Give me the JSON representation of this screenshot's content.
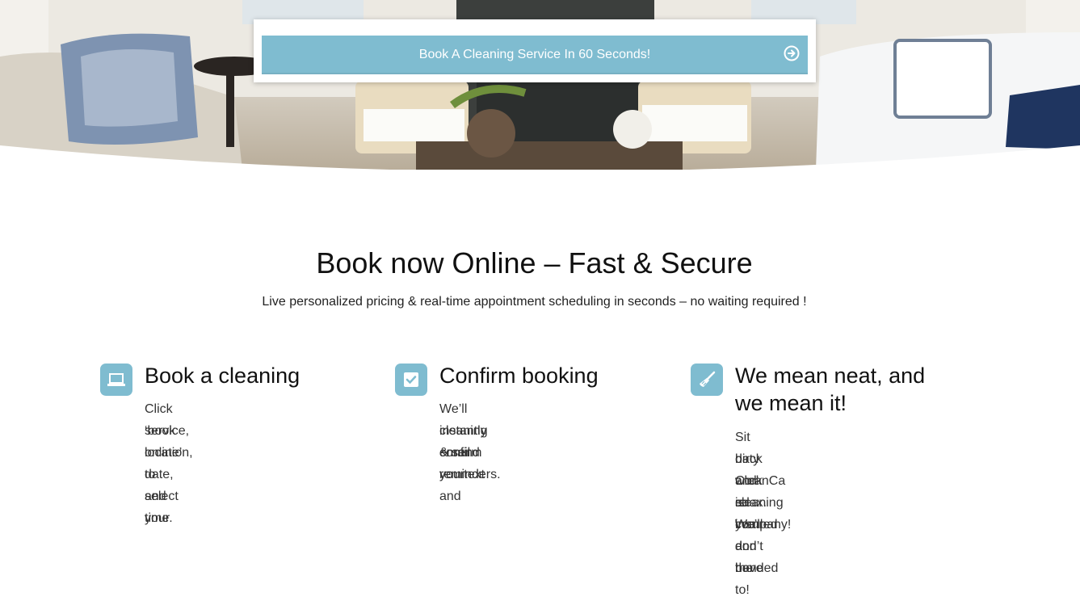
{
  "hero": {
    "book_label": "Book A Cleaning Service In 60 Seconds!",
    "book_icon": "circle-arrow-right-icon",
    "accent_color": "#7fbcd0"
  },
  "intro": {
    "title": "Book now Online – Fast & Secure",
    "subtitle": "Live personalized pricing & real-time appointment scheduling in seconds – no waiting required !"
  },
  "features": [
    {
      "icon": "laptop-icon",
      "title": "Book a cleaning",
      "lines": [
        "Click ‘book online’ to select your",
        "service, location, date, and time."
      ]
    },
    {
      "icon": "checkbox-icon",
      "title": "Confirm booking",
      "lines": [
        "We’ll instantly confirm your",
        "cleaning & send you text and",
        "email reminders."
      ]
    },
    {
      "icon": "broom-icon",
      "title_lines": [
        "We mean neat, and",
        "we mean it!"
      ],
      "lines": [
        "Sit back and relax. We’ll do the",
        "dirty work so you don’t have to!",
        "CleanCa is insured and bonded",
        "cleaning company!"
      ]
    }
  ]
}
